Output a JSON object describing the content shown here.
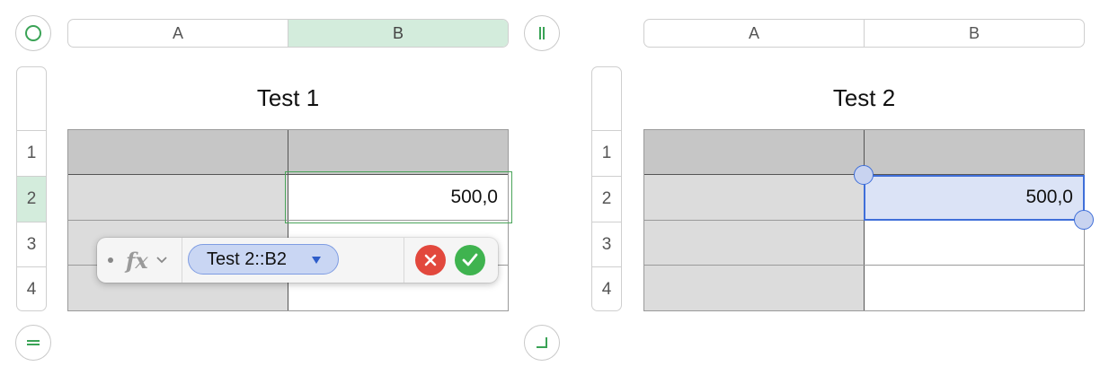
{
  "tables": [
    {
      "title": "Test 1",
      "columns": [
        "A",
        "B"
      ],
      "selected_column": "B",
      "rows": [
        "1",
        "2",
        "3",
        "4"
      ],
      "selected_row": "2",
      "cells": {
        "B2": "500,0"
      }
    },
    {
      "title": "Test 2",
      "columns": [
        "A",
        "B"
      ],
      "rows": [
        "1",
        "2",
        "3",
        "4"
      ],
      "cells": {
        "B2": "500,0"
      }
    }
  ],
  "formula_bar": {
    "fx_label": "fx",
    "reference_token": "Test 2::B2",
    "cancel_icon": "x-circle-icon",
    "accept_icon": "checkmark-circle-icon"
  },
  "colors": {
    "selection_green": "#d3ecdc",
    "selection_blue": "#dbe3f6",
    "cancel_red": "#e2483d",
    "accept_green": "#3fb34f"
  }
}
